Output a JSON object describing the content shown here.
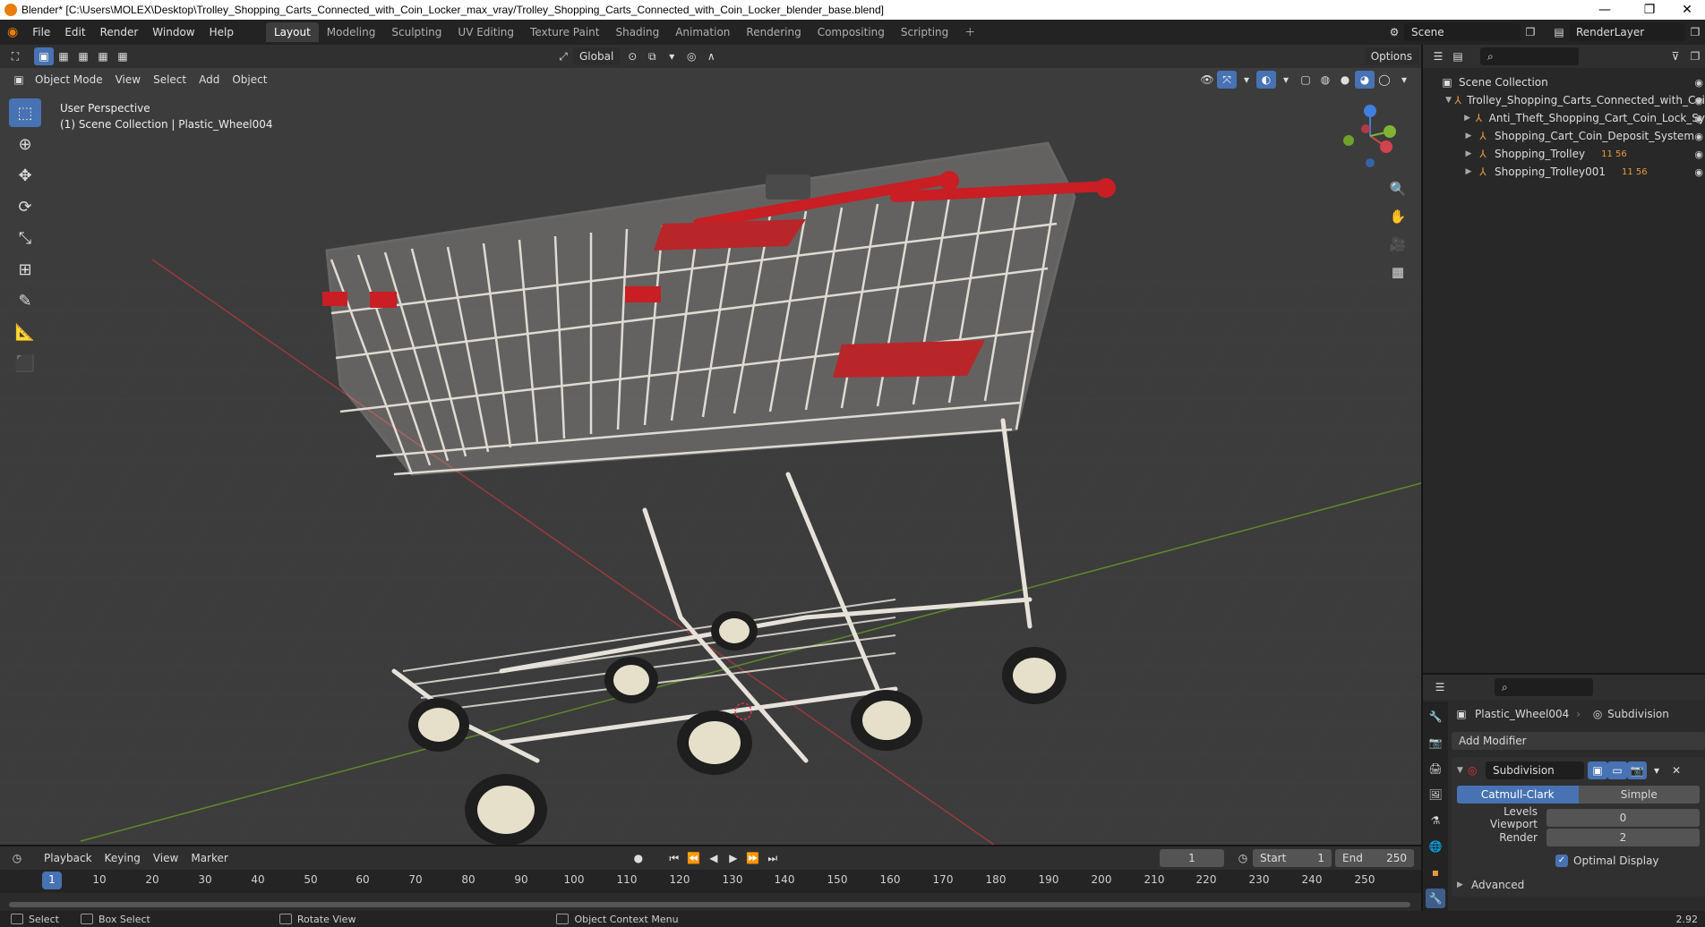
{
  "window": {
    "title": "Blender* [C:\\Users\\MOLEX\\Desktop\\Trolley_Shopping_Carts_Connected_with_Coin_Locker_max_vray/Trolley_Shopping_Carts_Connected_with_Coin_Locker_blender_base.blend]"
  },
  "menu": [
    "File",
    "Edit",
    "Render",
    "Window",
    "Help"
  ],
  "workspaces": [
    "Layout",
    "Modeling",
    "Sculpting",
    "UV Editing",
    "Texture Paint",
    "Shading",
    "Animation",
    "Rendering",
    "Compositing",
    "Scripting"
  ],
  "active_workspace": "Layout",
  "scene_name": "Scene",
  "render_layer": "RenderLayer",
  "viewport": {
    "mode": "Object Mode",
    "header_menus": [
      "View",
      "Select",
      "Add",
      "Object"
    ],
    "transform_orientation": "Global",
    "options_label": "Options",
    "info_line1": "User Perspective",
    "info_line2": "(1) Scene Collection | Plastic_Wheel004"
  },
  "outliner": {
    "root": "Scene Collection",
    "items": [
      {
        "label": "Trolley_Shopping_Carts_Connected_with_Coi",
        "level": 1
      },
      {
        "label": "Anti_Theft_Shopping_Cart_Coin_Lock_Sy",
        "level": 2
      },
      {
        "label": "Shopping_Cart_Coin_Deposit_System",
        "level": 2
      },
      {
        "label": "Shopping_Trolley",
        "level": 2,
        "badge": "11 56"
      },
      {
        "label": "Shopping_Trolley001",
        "level": 2,
        "badge": "11 56"
      }
    ]
  },
  "properties": {
    "object_name": "Plastic_Wheel004",
    "modifier_context": "Subdivision",
    "add_modifier": "Add Modifier",
    "modifier_name": "Subdivision",
    "mode_catmull": "Catmull-Clark",
    "mode_simple": "Simple",
    "levels_viewport_label": "Levels Viewport",
    "levels_viewport_value": "0",
    "render_label": "Render",
    "render_value": "2",
    "optimal_display": "Optimal Display",
    "advanced": "Advanced"
  },
  "timeline": {
    "menus": [
      "Playback",
      "Keying",
      "View",
      "Marker"
    ],
    "current_frame": "1",
    "start_label": "Start",
    "start_value": "1",
    "end_label": "End",
    "end_value": "250",
    "ticks": [
      "1",
      "10",
      "20",
      "30",
      "40",
      "50",
      "60",
      "70",
      "80",
      "90",
      "100",
      "110",
      "120",
      "130",
      "140",
      "150",
      "160",
      "170",
      "180",
      "190",
      "200",
      "210",
      "220",
      "230",
      "240",
      "250"
    ]
  },
  "status": {
    "select": "Select",
    "box_select": "Box Select",
    "rotate_view": "Rotate View",
    "context_menu": "Object Context Menu",
    "version": "2.92"
  },
  "colors": {
    "accent": "#4772b3",
    "cart_red": "#c81e24",
    "cart_white": "#e8e4dc",
    "x_axis": "#d0434f",
    "y_axis": "#7fb433",
    "z_axis": "#3f7fdf"
  }
}
